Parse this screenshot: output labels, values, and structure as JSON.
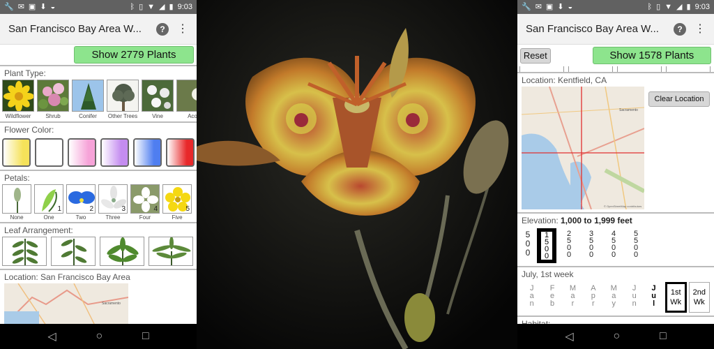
{
  "status": {
    "time_left": "9:03",
    "time_right": "9:03"
  },
  "app": {
    "title_left": "San Francisco Bay Area W...",
    "title_right": "San Francisco Bay Area W...",
    "help": "?",
    "menu": "⋮"
  },
  "left": {
    "show_button": "Show 2779 Plants",
    "plant_type": {
      "label": "Plant Type:",
      "items": [
        {
          "label": "Wildflower"
        },
        {
          "label": "Shrub"
        },
        {
          "label": "Conifer"
        },
        {
          "label": "Other Trees"
        },
        {
          "label": "Vine"
        },
        {
          "label": "Aco"
        }
      ]
    },
    "flower_color": {
      "label": "Flower Color:",
      "colors": [
        "#f5e25a",
        "#ffffff",
        "#f6a3d8",
        "#c48cf0",
        "#4f7ef0",
        "#e8282a"
      ]
    },
    "petals": {
      "label": "Petals:",
      "items": [
        {
          "label": "None",
          "num": ""
        },
        {
          "label": "One",
          "num": "1"
        },
        {
          "label": "Two",
          "num": "2"
        },
        {
          "label": "Three",
          "num": "3"
        },
        {
          "label": "Four",
          "num": "4"
        },
        {
          "label": "Five",
          "num": "5"
        }
      ]
    },
    "leaf": {
      "label": "Leaf Arrangement:"
    },
    "location": {
      "label": "Location: San Francisco Bay Area",
      "map_city": "Sacramento"
    }
  },
  "right": {
    "reset_button": "Reset",
    "show_button": "Show 1578 Plants",
    "location": {
      "label": "Location: Kentfield, CA",
      "clear": "Clear Location",
      "map_credit": "© OpenStreetMap contributors",
      "map_city": "Sacramento"
    },
    "elevation": {
      "label": "Elevation: ",
      "value": "1,000 to 1,999 feet",
      "columns": [
        {
          "digits": [
            "5",
            "0",
            "0"
          ]
        },
        {
          "digits": [
            "1",
            "5",
            "0",
            "0"
          ]
        },
        {
          "digits": [
            "2",
            "5",
            "0",
            "0"
          ]
        },
        {
          "digits": [
            "3",
            "5",
            "0",
            "0"
          ]
        },
        {
          "digits": [
            "4",
            "5",
            "0",
            "0"
          ]
        },
        {
          "digits": [
            "5",
            "5",
            "0",
            "0"
          ]
        }
      ]
    },
    "season": {
      "label": "July, 1st week",
      "months": [
        {
          "letters": [
            "J",
            "a",
            "n"
          ]
        },
        {
          "letters": [
            "F",
            "e",
            "b"
          ]
        },
        {
          "letters": [
            "M",
            "a",
            "r"
          ]
        },
        {
          "letters": [
            "A",
            "p",
            "r"
          ]
        },
        {
          "letters": [
            "M",
            "a",
            "y"
          ]
        },
        {
          "letters": [
            "J",
            "u",
            "n"
          ]
        },
        {
          "letters": [
            "J",
            "u",
            "l"
          ]
        }
      ],
      "weeks": [
        {
          "line1": "1st",
          "line2": "Wk"
        },
        {
          "line1": "2nd",
          "line2": "Wk"
        }
      ]
    },
    "habitat": {
      "label": "Habitat:"
    }
  },
  "nav": {
    "back": "◁",
    "home": "○",
    "recent": "□"
  },
  "colors": {
    "status_bar": "#616161",
    "show_button": "#8de48d",
    "app_bar": "#f2f2f2"
  }
}
